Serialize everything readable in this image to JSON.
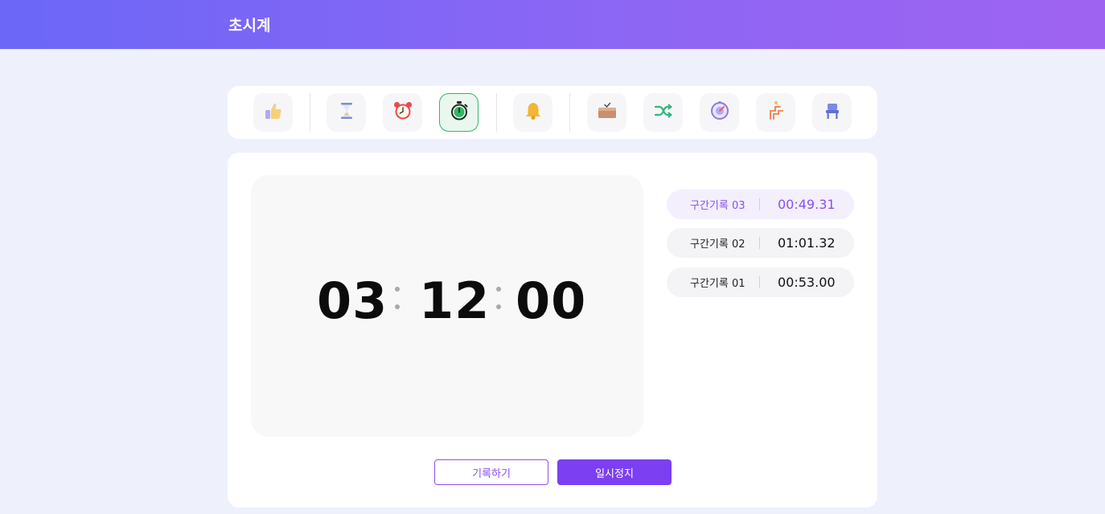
{
  "header": {
    "title": "초시계"
  },
  "toolbar": {
    "tools": [
      {
        "icon": "thumbs-up-icon"
      },
      {
        "icon": "hourglass-icon"
      },
      {
        "icon": "alarm-clock-icon"
      },
      {
        "icon": "stopwatch-icon",
        "active": true
      },
      {
        "icon": "bell-icon"
      },
      {
        "icon": "box-icon"
      },
      {
        "icon": "shuffle-icon"
      },
      {
        "icon": "clock-target-icon"
      },
      {
        "icon": "ladder-icon"
      },
      {
        "icon": "chair-icon"
      }
    ]
  },
  "stopwatch": {
    "hours": "03",
    "minutes": "12",
    "seconds": "00"
  },
  "laps": [
    {
      "label": "구간기록 03",
      "time": "00:49.31"
    },
    {
      "label": "구간기록 02",
      "time": "01:01.32"
    },
    {
      "label": "구간기록 01",
      "time": "00:53.00"
    }
  ],
  "buttons": {
    "record": "기록하기",
    "pause": "일시정지"
  },
  "colors": {
    "accent": "#7c3ff2",
    "active_tool": "#2fb866",
    "header_start": "#6b67f7",
    "header_end": "#9f63f1"
  }
}
